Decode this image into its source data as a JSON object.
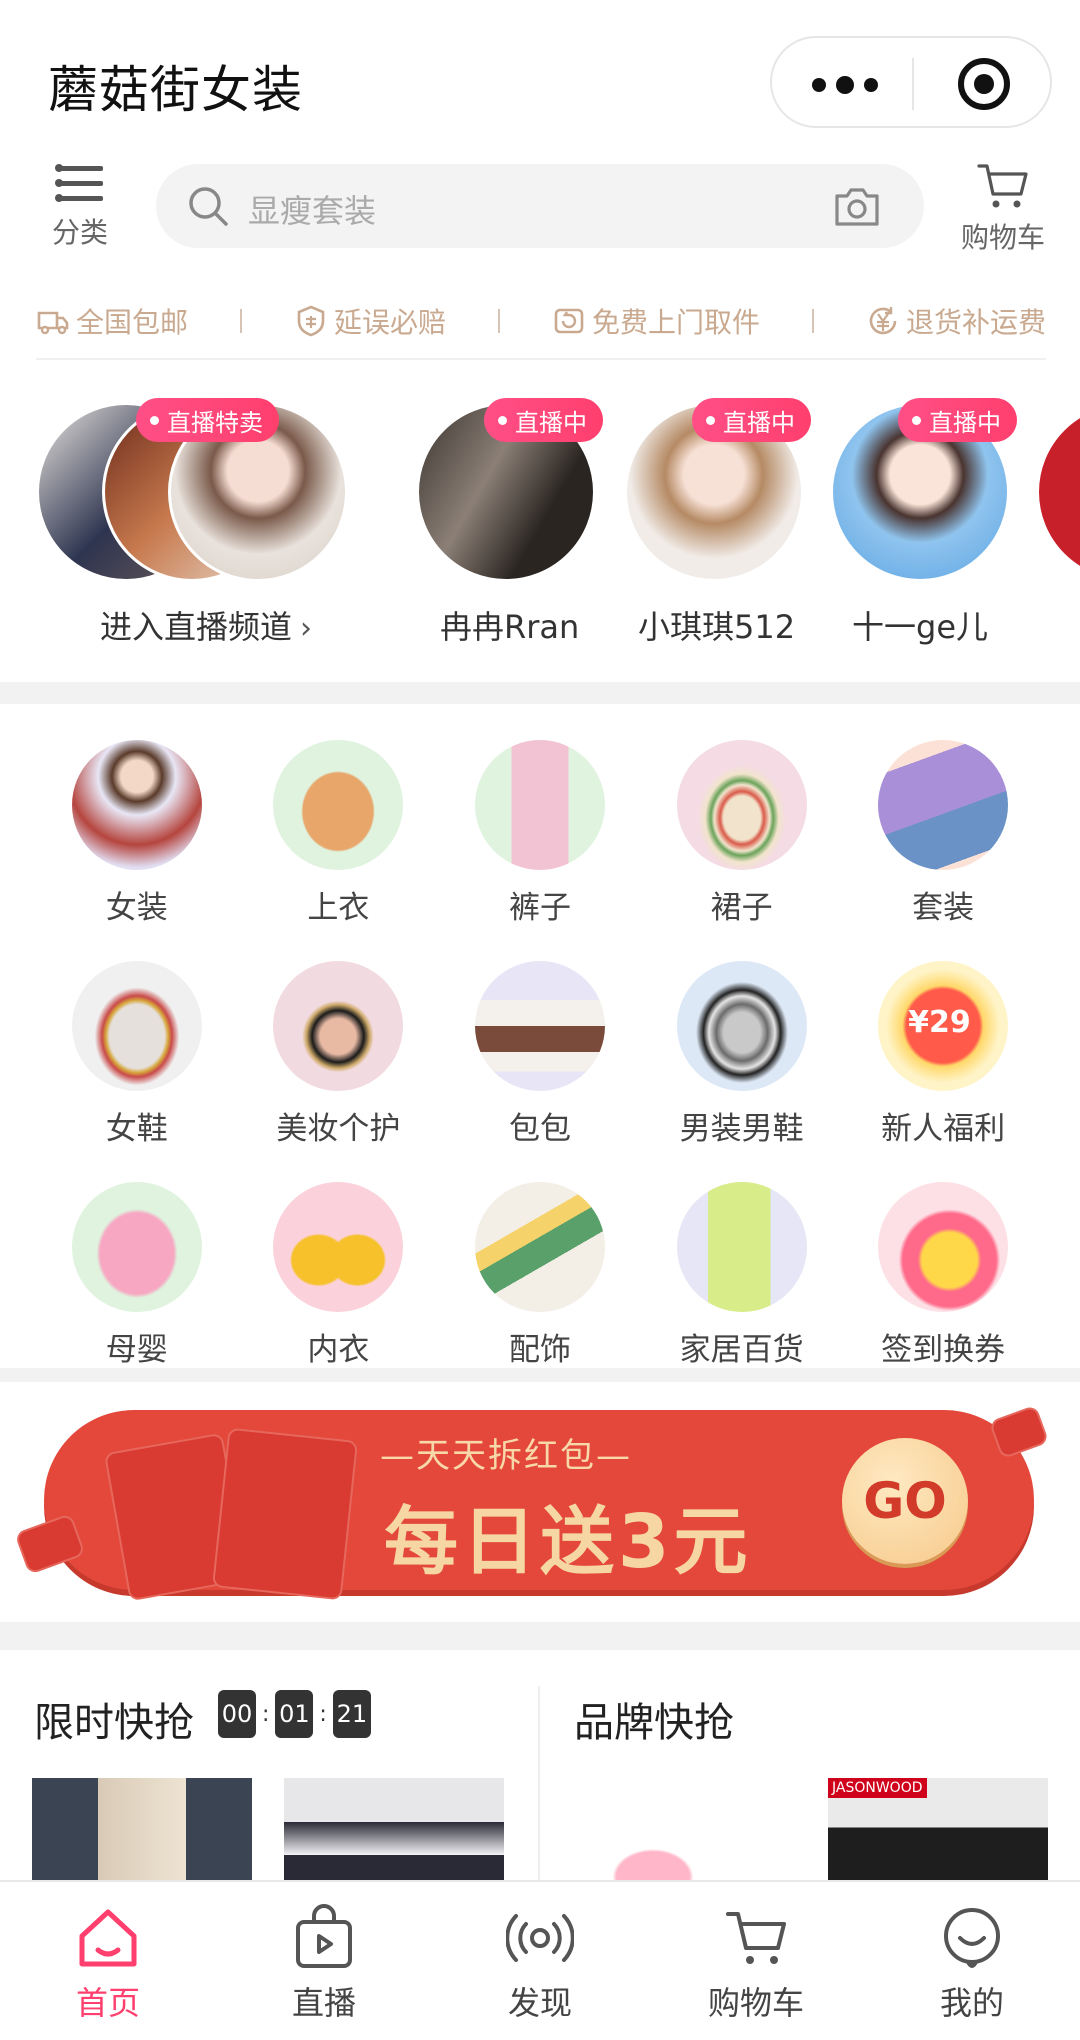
{
  "app": {
    "title": "蘑菇街女装"
  },
  "topbar": {
    "category_label": "分类",
    "search_placeholder": "显瘦套装",
    "cart_label": "购物车"
  },
  "guarantees": [
    "全国包邮",
    "延误必赔",
    "免费上门取件",
    "退货补运费"
  ],
  "live": {
    "channel": {
      "label": "进入直播频道",
      "tag": "直播特卖"
    },
    "anchors": [
      {
        "name": "冉冉Rran",
        "tag": "直播中"
      },
      {
        "name": "小琪琪512",
        "tag": "直播中"
      },
      {
        "name": "十一ge儿",
        "tag": "直播中"
      }
    ]
  },
  "categories": [
    {
      "label": "女装",
      "icon": "womens-clothing-icon"
    },
    {
      "label": "上衣",
      "icon": "top-icon"
    },
    {
      "label": "裤子",
      "icon": "pants-icon"
    },
    {
      "label": "裙子",
      "icon": "skirt-icon"
    },
    {
      "label": "套装",
      "icon": "outfit-set-icon"
    },
    {
      "label": "女鞋",
      "icon": "womens-shoes-icon"
    },
    {
      "label": "美妆个护",
      "icon": "cosmetics-icon"
    },
    {
      "label": "包包",
      "icon": "handbag-icon"
    },
    {
      "label": "男装男鞋",
      "icon": "menswear-icon"
    },
    {
      "label": "新人福利",
      "icon": "new-user-coupon-icon",
      "badge": "¥29"
    },
    {
      "label": "母婴",
      "icon": "baby-clothes-icon"
    },
    {
      "label": "内衣",
      "icon": "underwear-icon"
    },
    {
      "label": "配饰",
      "icon": "hair-clip-icon"
    },
    {
      "label": "家居百货",
      "icon": "mug-icon"
    },
    {
      "label": "签到换券",
      "icon": "checkin-coupon-icon"
    }
  ],
  "banner": {
    "subtitle": "—天天拆红包—",
    "headline": "每日送3元",
    "button": "GO"
  },
  "flash_sale": {
    "title": "限时快抢",
    "timer": [
      "00",
      "01",
      "21"
    ]
  },
  "brand_sale": {
    "title": "品牌快抢",
    "thumb_tag": "JASONWOOD"
  },
  "tabbar": [
    {
      "label": "首页",
      "active": true
    },
    {
      "label": "直播",
      "active": false
    },
    {
      "label": "发现",
      "active": false
    },
    {
      "label": "购物车",
      "active": false
    },
    {
      "label": "我的",
      "active": false
    }
  ],
  "colors": {
    "accent": "#ff3f6e",
    "guarantee": "#c9a98f",
    "banner": "#e4483b"
  }
}
